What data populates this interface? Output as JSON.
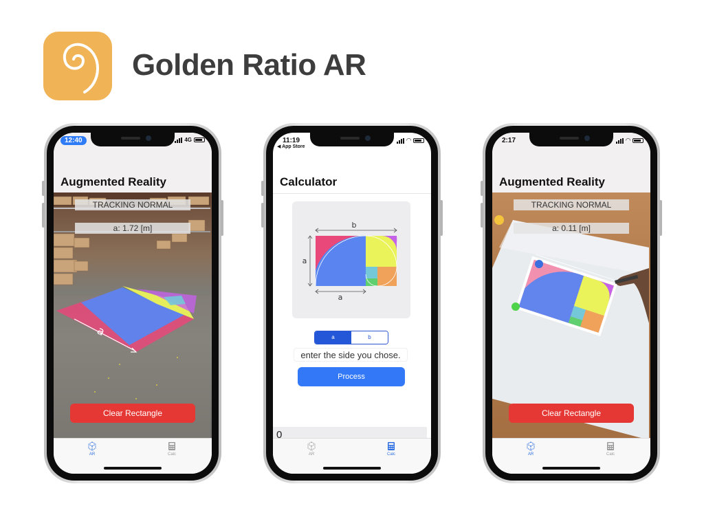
{
  "header": {
    "app_name": "Golden Ratio AR",
    "icon": "spiral-icon",
    "icon_color": "#f0b457"
  },
  "phones": [
    {
      "status_time": "12:40",
      "network": "4G",
      "nav_title": "Augmented Reality",
      "tracking_label": "TRACKING NORMAL",
      "measure_label": "a: 1.72 [m]",
      "clear_button": "Clear Rectangle",
      "tabs": [
        {
          "label": "AR",
          "icon": "ar-cube-icon",
          "active": true
        },
        {
          "label": "Calc",
          "icon": "calculator-icon",
          "active": false
        }
      ]
    },
    {
      "status_time": "11:19",
      "back_label": "◀ App Store",
      "nav_title": "Calculator",
      "diagram_labels": {
        "top": "b",
        "left": "a",
        "bottom": "a"
      },
      "segment_options": [
        "a",
        "b"
      ],
      "segment_selected": "a",
      "input_placeholder": "enter the side you chose.",
      "process_button": "Process",
      "result_value": "0",
      "tabs": [
        {
          "label": "AR",
          "icon": "ar-cube-icon",
          "active": false
        },
        {
          "label": "Calc",
          "icon": "calculator-icon",
          "active": true
        }
      ]
    },
    {
      "status_time": "2:17",
      "nav_title": "Augmented Reality",
      "tracking_label": "TRACKING NORMAL",
      "measure_label": "a: 0.11 [m]",
      "clear_button": "Clear Rectangle",
      "tabs": [
        {
          "label": "AR",
          "icon": "ar-cube-icon",
          "active": true
        },
        {
          "label": "Calc",
          "icon": "calculator-icon",
          "active": false
        }
      ]
    }
  ],
  "colors": {
    "accent_blue": "#3378f6",
    "clear_red": "#e53834",
    "golden_pink": "#e8487a",
    "golden_yellow": "#eaf35a",
    "golden_purple": "#c462e8",
    "golden_blue": "#5a85f0",
    "golden_orange": "#f0a15a",
    "golden_teal": "#74c8d8"
  }
}
